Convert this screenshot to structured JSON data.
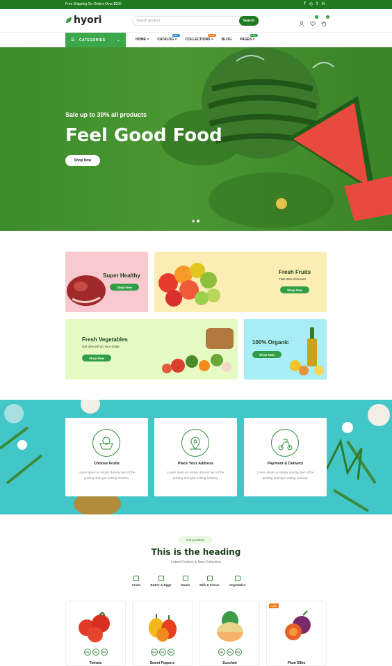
{
  "topbar": {
    "shipping": "Free Shipping On Orders Over $100",
    "social": [
      "f",
      "◎",
      "t",
      "in"
    ]
  },
  "header": {
    "logo": "hyori",
    "search_placeholder": "Search product",
    "search_button": "Search",
    "wishlist_count": "0",
    "cart_count": "0"
  },
  "nav": {
    "categories": "CATEGORIES",
    "items": [
      {
        "label": "HOME",
        "tag": ""
      },
      {
        "label": "CATALOG",
        "tag": "NEW"
      },
      {
        "label": "COLLECTIONS",
        "tag": "SALE"
      },
      {
        "label": "BLOG",
        "tag": ""
      },
      {
        "label": "PAGES",
        "tag": "NEW"
      }
    ]
  },
  "hero": {
    "sale": "Sale up to 30% all products",
    "title": "Feel Good Food",
    "button": "Shop Now"
  },
  "banners": {
    "healthy": {
      "title": "Super Healthy",
      "button": "Shop Now"
    },
    "fruits": {
      "title": "Fresh Fruits",
      "sub": "Flats 25% Discount",
      "button": "Shop Now"
    },
    "veg": {
      "title": "Fresh Vegetables",
      "sub": "Get 30% Off on Your Order",
      "button": "Shop Now"
    },
    "organic": {
      "title": "100% Organic",
      "button": "Shop Now"
    }
  },
  "features": [
    {
      "title": "Choose Fruits",
      "desc": "Lorem Ipsum is simply dummy text of the printing and type setting industry."
    },
    {
      "title": "Place Your Address",
      "desc": "Lorem Ipsum is simply dummy text of the printing and type setting industry."
    },
    {
      "title": "Payment & Delivery",
      "desc": "Lorem Ipsum is simply dummy text of the printing and type setting industry."
    }
  ],
  "products_section": {
    "pill": "Our products",
    "heading": "This is the heading",
    "sub": "Latest Product & New Collection",
    "tabs": [
      "Fruits",
      "Butter & Eggs",
      "Meats",
      "Milk & Cream",
      "Vegetables"
    ]
  },
  "products": [
    {
      "name": "Tomato",
      "weights": [
        "1kg",
        "2kg",
        "3kg"
      ],
      "badge": ""
    },
    {
      "name": "Sweet Peppers",
      "weights": [
        "1kg",
        "2kg",
        "3kg"
      ],
      "badge": ""
    },
    {
      "name": "Zucchini",
      "weights": [
        "1kg",
        "2kg",
        "3kg"
      ],
      "badge": ""
    },
    {
      "name": "Plum Silho",
      "weights": [],
      "badge": "Sale"
    }
  ],
  "colors": {
    "brand": "#1f7a1f",
    "accent": "#2f9e44",
    "hero": "#4a9732",
    "teal": "#43c6c8"
  }
}
